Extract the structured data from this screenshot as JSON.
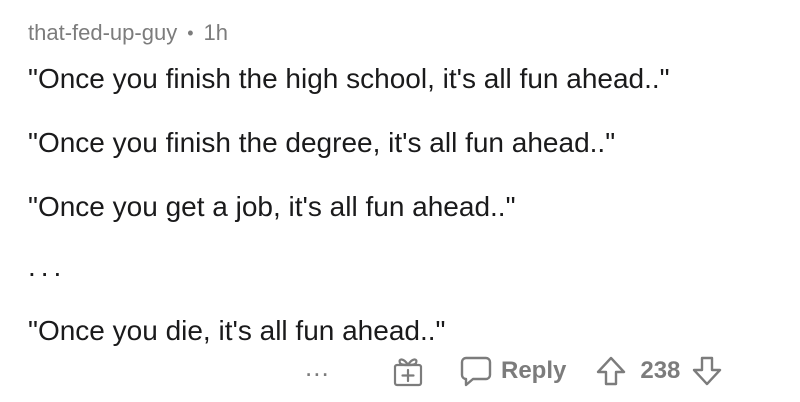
{
  "comment": {
    "author": "that-fed-up-guy",
    "separator": "•",
    "age": "1h",
    "lines": [
      "\"Once you finish the high school, it's all fun ahead..\"",
      "\"Once you finish the degree, it's all fun ahead..\"",
      "\"Once you get a job, it's all fun ahead..\"",
      "...",
      "\"Once you die, it's all fun ahead..\""
    ]
  },
  "actions": {
    "more": "...",
    "award_icon": "gift-icon",
    "reply_icon": "speech-bubble-icon",
    "reply_label": "Reply",
    "upvote_icon": "arrow-up-icon",
    "score": "238",
    "downvote_icon": "arrow-down-icon"
  }
}
